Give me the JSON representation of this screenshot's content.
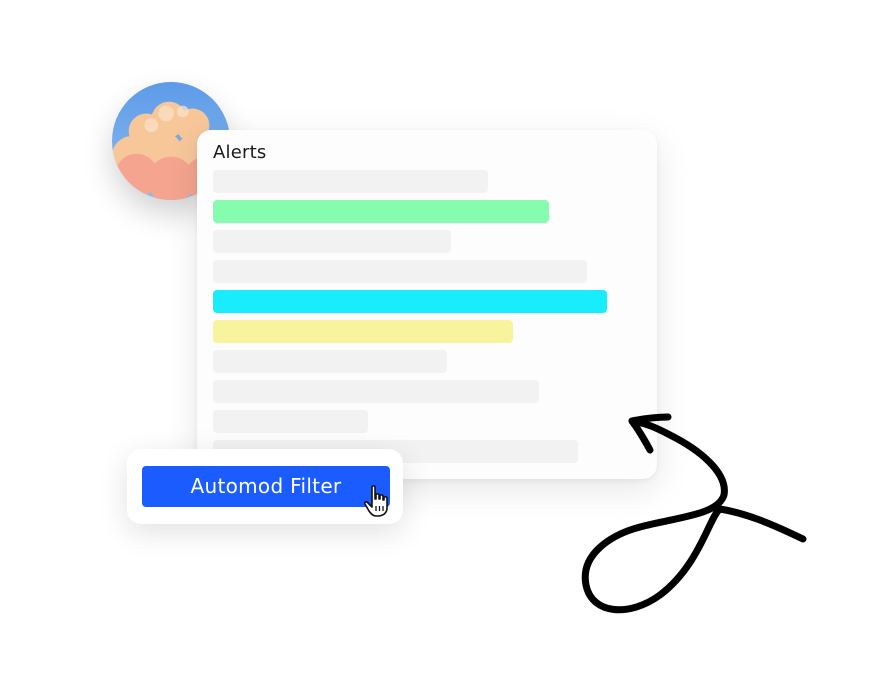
{
  "panel": {
    "title": "Alerts"
  },
  "filter": {
    "button_label": "Automod Filter"
  },
  "colors": {
    "row_highlight_green": "#86fdae",
    "row_highlight_cyan": "#19ecfc",
    "row_highlight_yellow": "#f8f49d",
    "button_blue": "#1a5cff"
  },
  "icons": {
    "avatar": "sky-clouds-avatar-icon",
    "cursor": "hand-pointer-icon",
    "arrow": "curly-arrow-icon"
  }
}
